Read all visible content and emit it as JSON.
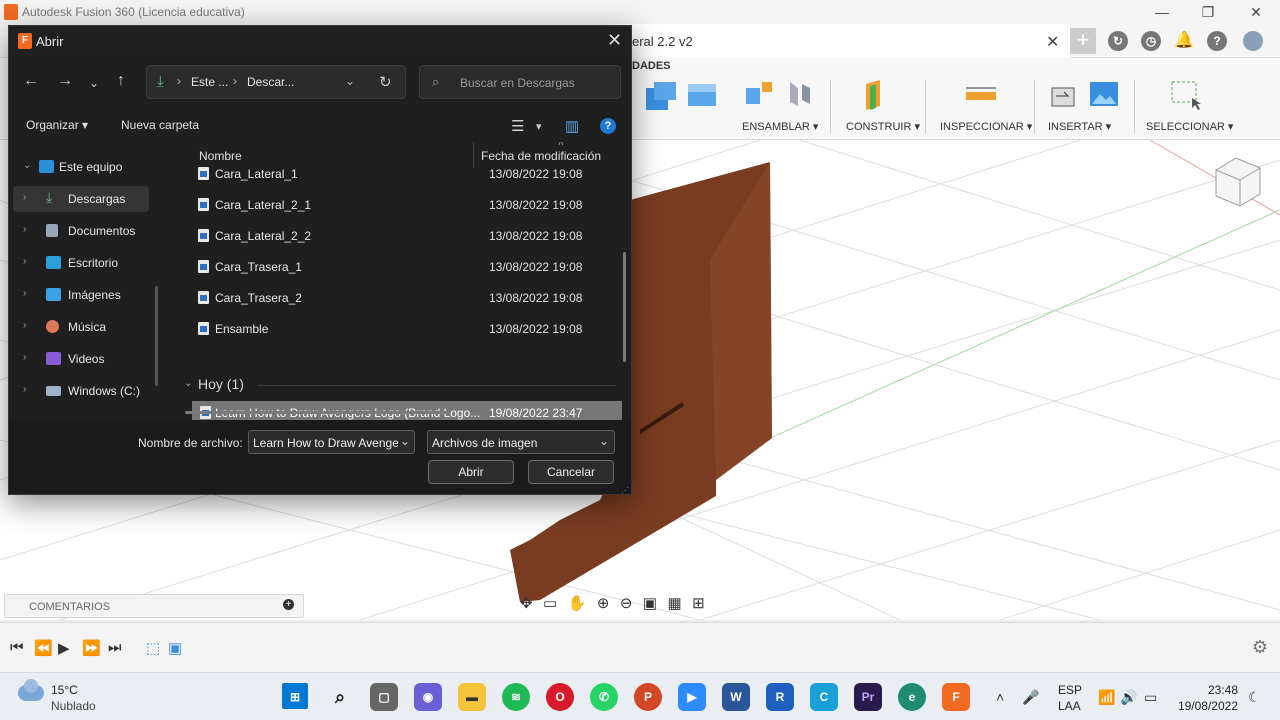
{
  "app": {
    "window_title": "Autodesk Fusion 360 (Licencia educativa)",
    "doc_tab_title": "eral 2.2 v2",
    "ribbon_tab": "DADES",
    "ribbon_groups": [
      "ENSAMBLAR ▾",
      "CONSTRUIR ▾",
      "INSPECCIONAR ▾",
      "INSERTAR ▾",
      "SELECCIONAR ▾"
    ],
    "comments_label": "COMENTARIOS",
    "accent_color": "#f26b21"
  },
  "dialog": {
    "title": "Abrir",
    "address": [
      "Este ...",
      "Descar..."
    ],
    "search_placeholder": "Buscar en Descargas",
    "organize_label": "Organizar ▾",
    "new_folder_label": "Nueva carpeta",
    "nav_items": [
      {
        "label": "Este equipo",
        "icon": "computer-icon"
      },
      {
        "label": "Descargas",
        "icon": "download-icon"
      },
      {
        "label": "Documentos",
        "icon": "document-icon"
      },
      {
        "label": "Escritorio",
        "icon": "desktop-icon"
      },
      {
        "label": "Imágenes",
        "icon": "pictures-icon"
      },
      {
        "label": "Música",
        "icon": "music-icon"
      },
      {
        "label": "Videos",
        "icon": "video-icon"
      },
      {
        "label": "Windows (C:)",
        "icon": "drive-icon"
      }
    ],
    "columns": {
      "name": "Nombre",
      "date": "Fecha de modificación"
    },
    "files": [
      {
        "name": "Cara_Lateral_1",
        "date": "13/08/2022 19:08"
      },
      {
        "name": "Cara_Lateral_2_1",
        "date": "13/08/2022 19:08"
      },
      {
        "name": "Cara_Lateral_2_2",
        "date": "13/08/2022 19:08"
      },
      {
        "name": "Cara_Trasera_1",
        "date": "13/08/2022 19:08"
      },
      {
        "name": "Cara_Trasera_2",
        "date": "13/08/2022 19:08"
      },
      {
        "name": "Ensamble",
        "date": "13/08/2022 19:08"
      }
    ],
    "group_label": "Hoy (1)",
    "today_files": [
      {
        "name": "Learn How to Draw Avengers Logo (Brand Logo...",
        "date": "19/08/2022 23:47"
      }
    ],
    "filename_label": "Nombre de archivo:",
    "filename_value": "Learn How to Draw Avengers Logo",
    "filetype_value": "Archivos de imagen",
    "open_button": "Abrir",
    "cancel_button": "Cancelar"
  },
  "taskbar": {
    "temperature": "15°C",
    "condition": "Nublado",
    "lang_line1": "ESP",
    "lang_line2": "LAA",
    "time": "23:48",
    "date": "19/08/2022"
  }
}
